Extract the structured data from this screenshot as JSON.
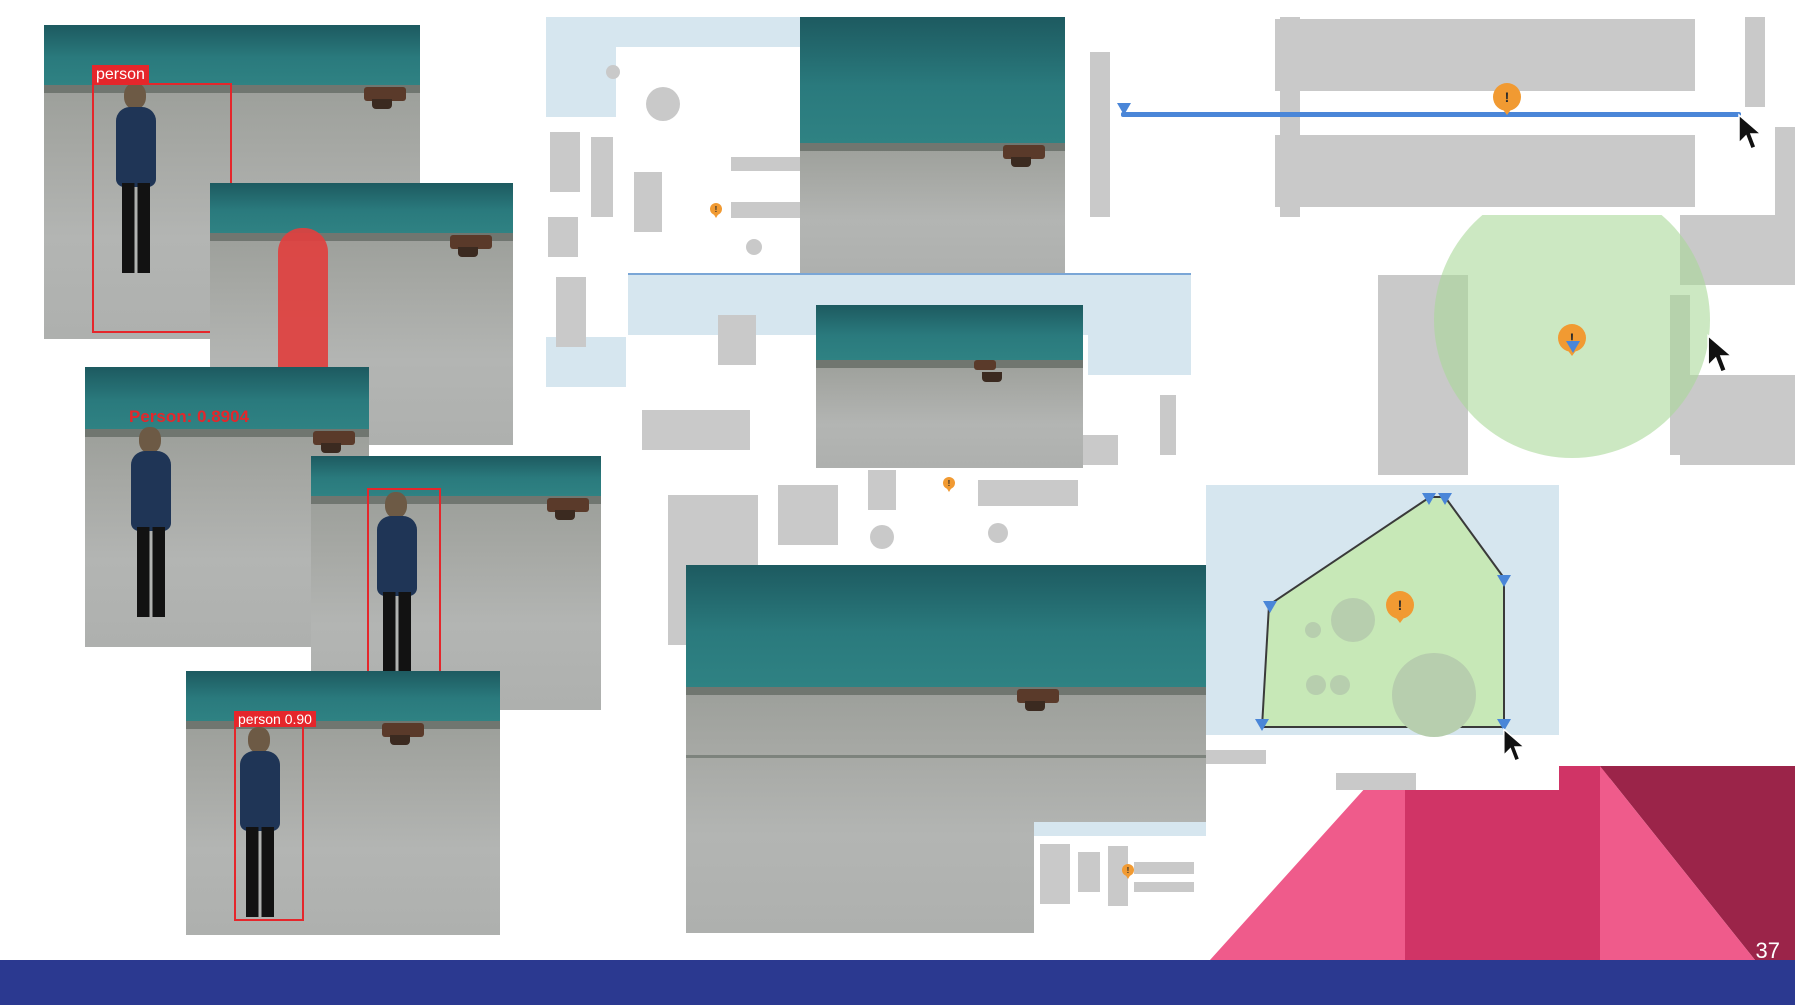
{
  "slide": {
    "page_number": "37",
    "colors": {
      "footer": "#2b3990",
      "accent_pink": "#ef5b8b",
      "accent_magenta": "#d03466",
      "accent_wine": "#9b2449"
    }
  },
  "detections": {
    "label_person": "person",
    "label_person_score": "Person: 0.8904",
    "label_person_090": "person 0.90"
  },
  "icons": {
    "warning": "warning-icon",
    "cursor": "mouse-cursor-icon",
    "vertex": "vertex-marker-icon"
  }
}
